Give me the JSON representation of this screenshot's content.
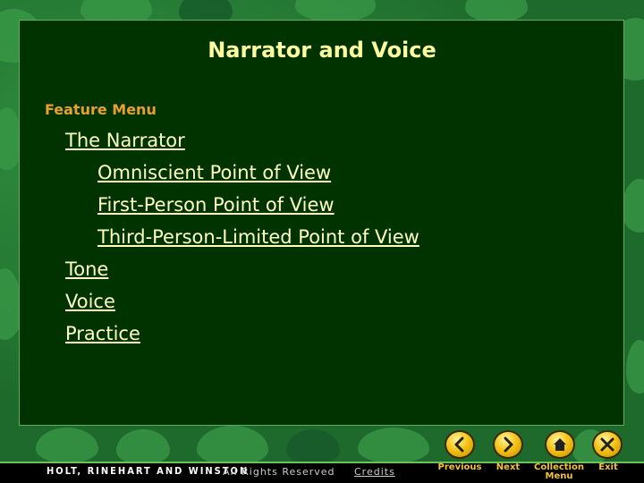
{
  "title": "Narrator and Voice",
  "feature_menu_label": "Feature Menu",
  "menu": [
    {
      "label": "The Narrator",
      "level": 0
    },
    {
      "label": "Omniscient Point of View",
      "level": 1
    },
    {
      "label": "First-Person Point of View",
      "level": 1
    },
    {
      "label": "Third-Person-Limited Point of View",
      "level": 1
    },
    {
      "label": "Tone",
      "level": 0
    },
    {
      "label": "Voice",
      "level": 0
    },
    {
      "label": "Practice",
      "level": 0
    }
  ],
  "footer": {
    "publisher": "HOLT, RINEHART AND WINSTON",
    "rights": "All Rights Reserved",
    "credits": "Credits"
  },
  "nav": {
    "previous": {
      "label": "Previous",
      "icon": "chevron-left-icon"
    },
    "next": {
      "label": "Next",
      "icon": "chevron-right-icon"
    },
    "collection": {
      "label": "Collection Menu",
      "icon": "home-icon"
    },
    "exit": {
      "label": "Exit",
      "icon": "close-icon"
    }
  },
  "colors": {
    "panel": "#003300",
    "title": "#ffffa0",
    "feature_label": "#e8a030",
    "link": "#ffffc0",
    "nav_label": "#f2c23a"
  }
}
